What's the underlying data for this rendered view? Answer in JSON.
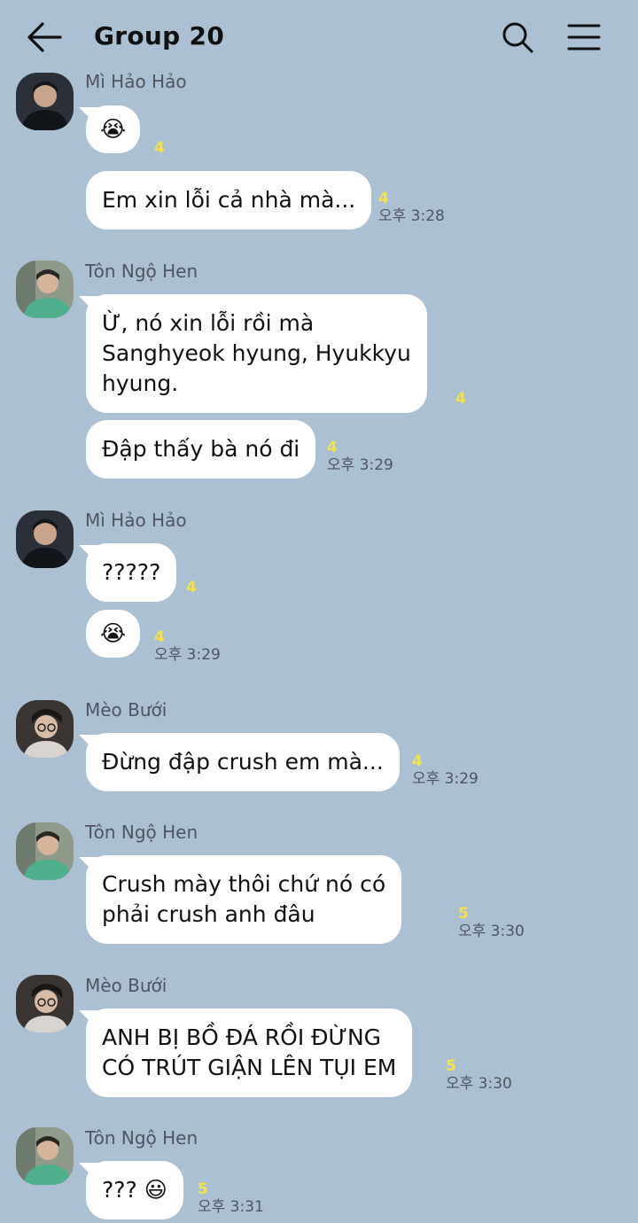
{
  "header": {
    "title": "Group 20",
    "back_icon": "arrow-left-icon",
    "search_icon": "search-icon",
    "menu_icon": "hamburger-menu-icon"
  },
  "colors": {
    "background": "#abc0d3",
    "bubble": "#ffffff",
    "unread_count": "#f5e24a",
    "meta_text": "#4f5560"
  },
  "messages": [
    {
      "sender": "Mì Hảo Hảo",
      "avatar": "avatar-dark-jacket",
      "bubbles": [
        {
          "text": "😭",
          "unread": "4",
          "time": ""
        },
        {
          "text": "Em xin lỗi cả nhà mà...",
          "unread": "4",
          "time": "오후 3:28"
        }
      ]
    },
    {
      "sender": "Tôn Ngộ Hen",
      "avatar": "avatar-green-shirt",
      "bubbles": [
        {
          "text": "Ừ, nó xin lỗi rồi mà\nSanghyeok hyung, Hyukkyu\nhyung.",
          "unread": "4",
          "time": ""
        },
        {
          "text": "Đập thấy bà nó đi",
          "unread": "4",
          "time": "오후 3:29"
        }
      ]
    },
    {
      "sender": "Mì Hảo Hảo",
      "avatar": "avatar-dark-jacket",
      "bubbles": [
        {
          "text": "?????",
          "unread": "4",
          "time": ""
        },
        {
          "text": "😭",
          "unread": "4",
          "time": "오후 3:29"
        }
      ]
    },
    {
      "sender": "Mèo Bưới",
      "avatar": "avatar-glasses",
      "bubbles": [
        {
          "text": "Đừng đập crush em mà...",
          "unread": "4",
          "time": "오후 3:29"
        }
      ]
    },
    {
      "sender": "Tôn Ngộ Hen",
      "avatar": "avatar-green-shirt",
      "bubbles": [
        {
          "text": "Crush mày thôi chứ nó có\nphải crush anh đâu",
          "unread": "5",
          "time": "오후 3:30"
        }
      ]
    },
    {
      "sender": "Mèo Bưới",
      "avatar": "avatar-glasses",
      "bubbles": [
        {
          "text": "ANH BỊ BỒ ĐÁ RỒI ĐỪNG\nCÓ TRÚT GIẬN LÊN TỤI EM",
          "unread": "5",
          "time": "오후 3:30"
        }
      ]
    },
    {
      "sender": "Tôn Ngộ Hen",
      "avatar": "avatar-green-shirt",
      "bubbles": [
        {
          "text": "??? 😃",
          "unread": "5",
          "time": "오후 3:31"
        }
      ]
    }
  ]
}
